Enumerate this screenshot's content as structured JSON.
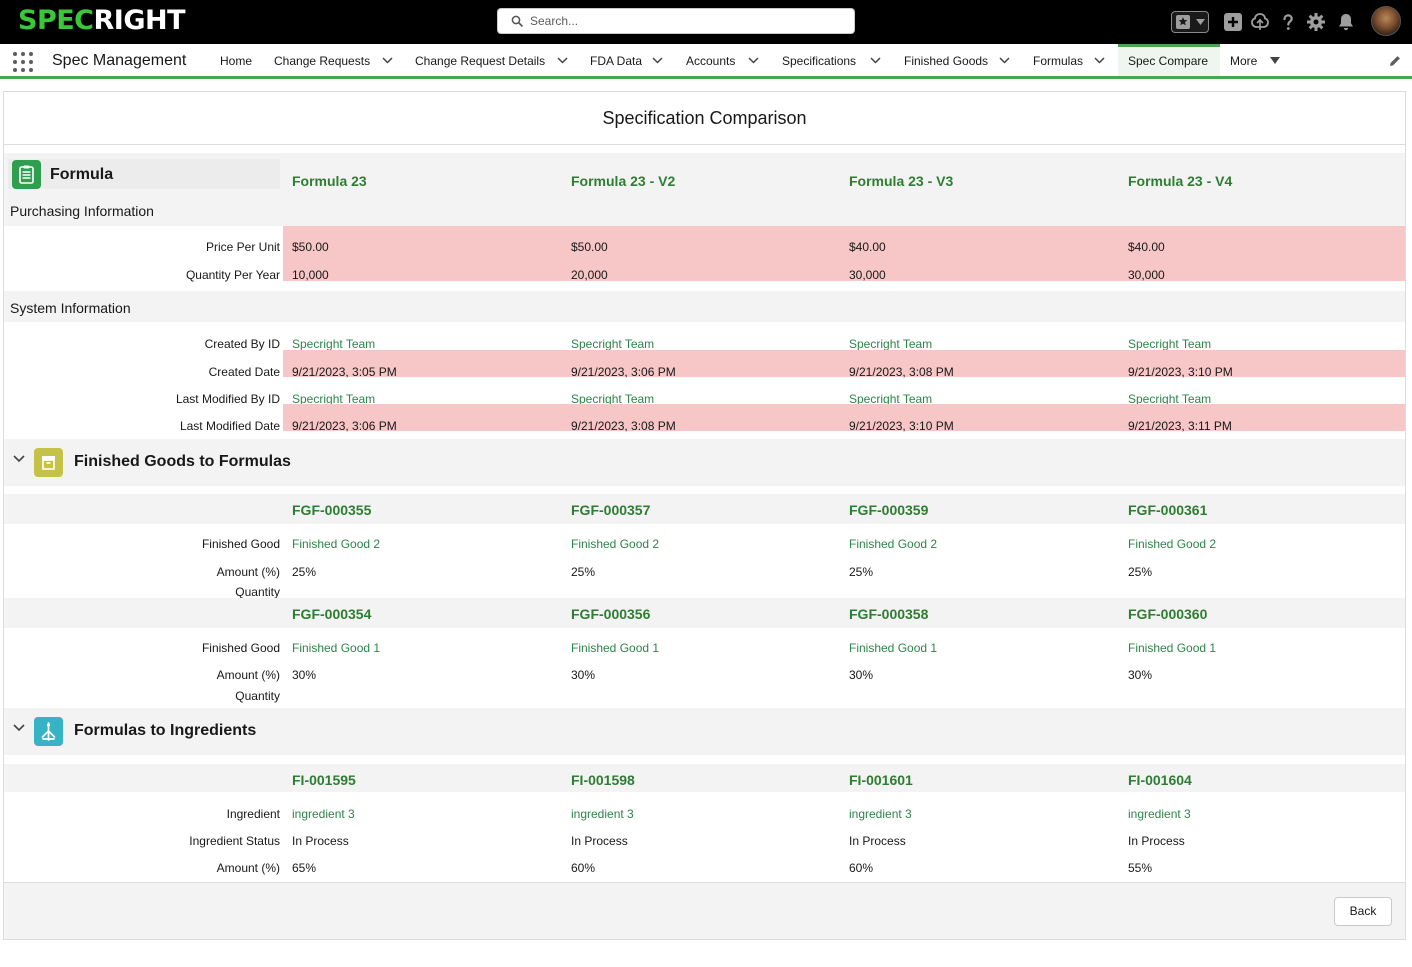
{
  "header": {
    "logo_part1": "SPEC",
    "logo_part2": "RIGHT",
    "search_placeholder": "Search...",
    "icons": [
      "favorites-star-icon",
      "add-icon",
      "trailhead-icon",
      "help-icon",
      "setup-gear-icon",
      "notifications-bell-icon",
      "user-avatar"
    ]
  },
  "nav": {
    "app_name": "Spec Management",
    "items": [
      {
        "label": "Home"
      },
      {
        "label": "Change Requests"
      },
      {
        "label": "Change Request Details"
      },
      {
        "label": "FDA Data"
      },
      {
        "label": "Accounts"
      },
      {
        "label": "Specifications"
      },
      {
        "label": "Finished Goods"
      },
      {
        "label": "Formulas"
      },
      {
        "label": "Spec Compare"
      },
      {
        "label": "More"
      }
    ],
    "active": "Spec Compare"
  },
  "page": {
    "title": "Specification Comparison"
  },
  "formula_section": {
    "label": "Formula",
    "columns": [
      "Formula 23",
      "Formula 23 - V2",
      "Formula 23 - V3",
      "Formula 23 - V4"
    ],
    "purchasing": {
      "heading": "Purchasing Information",
      "rows": [
        {
          "label": "Price Per Unit",
          "values": [
            "$50.00",
            "$50.00",
            "$40.00",
            "$40.00"
          ]
        },
        {
          "label": "Quantity Per Year",
          "values": [
            "10,000",
            "20,000",
            "30,000",
            "30,000"
          ]
        }
      ]
    },
    "system": {
      "heading": "System Information",
      "rows": [
        {
          "label": "Created By ID",
          "values": [
            "Specright Team",
            "Specright Team",
            "Specright Team",
            "Specright Team"
          ]
        },
        {
          "label": "Created Date",
          "values": [
            "9/21/2023, 3:05 PM",
            "9/21/2023, 3:06 PM",
            "9/21/2023, 3:08 PM",
            "9/21/2023, 3:10 PM"
          ]
        },
        {
          "label": "Last Modified By ID",
          "values": [
            "Specright Team",
            "Specright Team",
            "Specright Team",
            "Specright Team"
          ]
        },
        {
          "label": "Last Modified Date",
          "values": [
            "9/21/2023, 3:06 PM",
            "9/21/2023, 3:08 PM",
            "9/21/2023, 3:10 PM",
            "9/21/2023, 3:11 PM"
          ]
        }
      ]
    }
  },
  "fg_section": {
    "label": "Finished Goods to Formulas",
    "groups": [
      {
        "ids": [
          "FGF-000355",
          "FGF-000357",
          "FGF-000359",
          "FGF-000361"
        ],
        "rows": [
          {
            "label": "Finished Good",
            "values": [
              "Finished Good 2",
              "Finished Good 2",
              "Finished Good 2",
              "Finished Good 2"
            ]
          },
          {
            "label": "Amount (%)",
            "values": [
              "25%",
              "25%",
              "25%",
              "25%"
            ]
          },
          {
            "label": "Quantity",
            "values": [
              "",
              "",
              "",
              ""
            ]
          }
        ]
      },
      {
        "ids": [
          "FGF-000354",
          "FGF-000356",
          "FGF-000358",
          "FGF-000360"
        ],
        "rows": [
          {
            "label": "Finished Good",
            "values": [
              "Finished Good 1",
              "Finished Good 1",
              "Finished Good 1",
              "Finished Good 1"
            ]
          },
          {
            "label": "Amount (%)",
            "values": [
              "30%",
              "30%",
              "30%",
              "30%"
            ]
          },
          {
            "label": "Quantity",
            "values": [
              "",
              "",
              "",
              ""
            ]
          }
        ]
      }
    ]
  },
  "fi_section": {
    "label": "Formulas to Ingredients",
    "ids": [
      "FI-001595",
      "FI-001598",
      "FI-001601",
      "FI-001604"
    ],
    "rows": [
      {
        "label": "Ingredient",
        "values": [
          "ingredient 3",
          "ingredient 3",
          "ingredient 3",
          "ingredient 3"
        ]
      },
      {
        "label": "Ingredient Status",
        "values": [
          "In Process",
          "In Process",
          "In Process",
          "In Process"
        ]
      },
      {
        "label": "Amount (%)",
        "values": [
          "65%",
          "60%",
          "60%",
          "55%"
        ]
      }
    ]
  },
  "footer": {
    "back_label": "Back"
  },
  "colors": {
    "brand_green": "#3ac83a",
    "heading_green": "#2e7d32",
    "link_green": "#2e844a",
    "diff_highlight": "#f7c6c6",
    "nav_accent": "#4aa553"
  }
}
